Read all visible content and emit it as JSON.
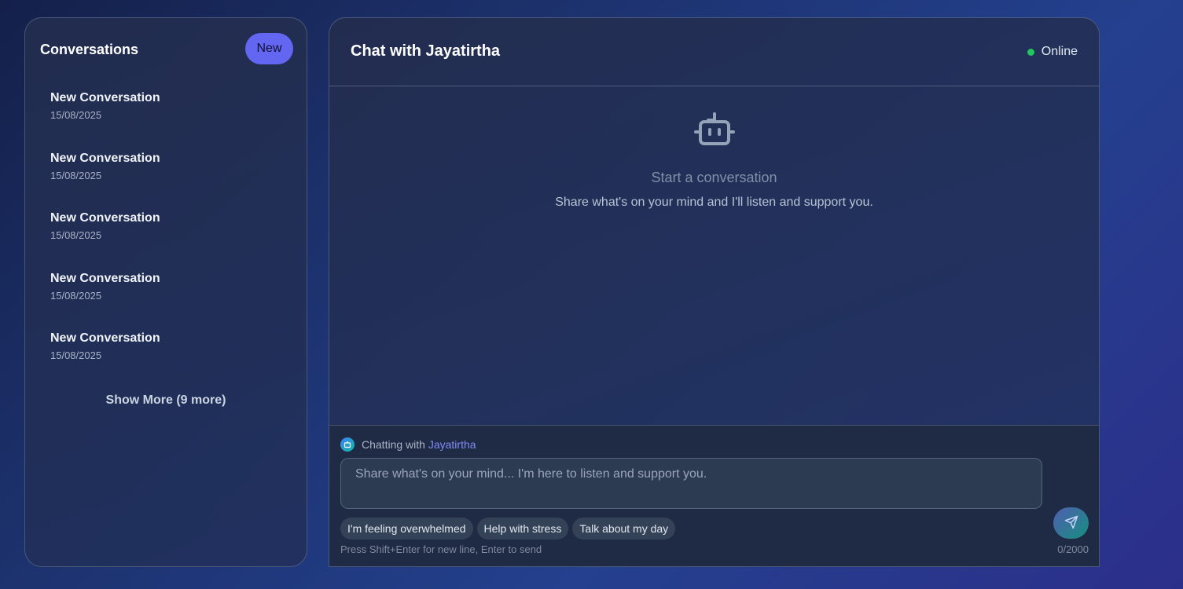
{
  "sidebar": {
    "title": "Conversations",
    "new_label": "New",
    "conversations": [
      {
        "title": "New Conversation",
        "date": "15/08/2025"
      },
      {
        "title": "New Conversation",
        "date": "15/08/2025"
      },
      {
        "title": "New Conversation",
        "date": "15/08/2025"
      },
      {
        "title": "New Conversation",
        "date": "15/08/2025"
      },
      {
        "title": "New Conversation",
        "date": "15/08/2025"
      }
    ],
    "show_more_label": "Show More (9 more)"
  },
  "chat": {
    "title": "Chat with Jayatirtha",
    "status": "Online",
    "status_color": "#22c55e",
    "empty": {
      "icon": "robot-icon",
      "title": "Start a conversation",
      "subtitle": "Share what's on your mind and I'll listen and support you."
    },
    "composer": {
      "chatting_prefix": "Chatting with",
      "agent_name": "Jayatirtha",
      "placeholder": "Share what's on your mind... I'm here to listen and support you.",
      "value": "",
      "suggestions": [
        "I'm feeling overwhelmed",
        "Help with stress",
        "Talk about my day"
      ],
      "hint": "Press Shift+Enter for new line, Enter to send",
      "counter": "0/2000",
      "send_icon": "send-icon"
    }
  },
  "colors": {
    "accent": "#6366f1",
    "agent_name": "#818cf8",
    "online": "#22c55e"
  }
}
